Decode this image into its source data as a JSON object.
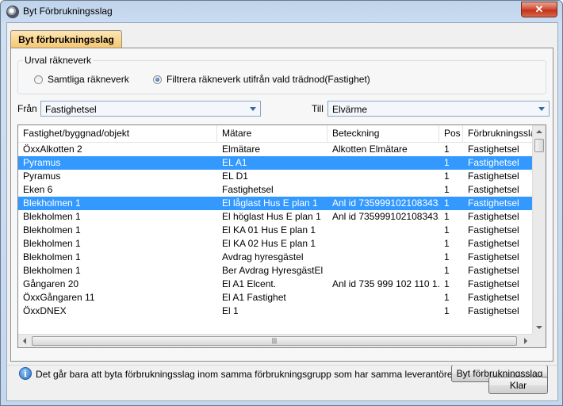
{
  "window": {
    "title": "Byt Förbrukningsslag",
    "close_label": "✕"
  },
  "tab": {
    "label": "Byt förbrukningsslag"
  },
  "urval": {
    "legend": "Urval räkneverk",
    "option_all": "Samtliga räkneverk",
    "option_filter": "Filtrera räkneverk utifrån vald trädnod(Fastighet)",
    "selected": "filter"
  },
  "from": {
    "label": "Från",
    "value": "Fastighetsel"
  },
  "to": {
    "label": "Till",
    "value": "Elvärme"
  },
  "table": {
    "columns": [
      "Fastighet/byggnad/objekt",
      "Mätare",
      "Beteckning",
      "Pos",
      "Förbrukningsslag"
    ],
    "rows": [
      {
        "c": [
          "ÖxxAlkotten 2",
          "Elmätare",
          "Alkotten Elmätare",
          "1",
          "Fastighetsel"
        ],
        "selected": false
      },
      {
        "c": [
          "Pyramus",
          "EL A1",
          "",
          "1",
          "Fastighetsel"
        ],
        "selected": true
      },
      {
        "c": [
          "Pyramus",
          "EL D1",
          "",
          "1",
          "Fastighetsel"
        ],
        "selected": false
      },
      {
        "c": [
          "Eken 6",
          "Fastighetsel",
          "",
          "1",
          "Fastighetsel"
        ],
        "selected": false
      },
      {
        "c": [
          "Blekholmen 1",
          "El låglast Hus E plan 1",
          "Anl id 735999102108343...",
          "1",
          "Fastighetsel"
        ],
        "selected": true
      },
      {
        "c": [
          "Blekholmen 1",
          "El höglast Hus E plan 1",
          "Anl id 735999102108343...",
          "1",
          "Fastighetsel"
        ],
        "selected": false
      },
      {
        "c": [
          "Blekholmen 1",
          "El KA 01 Hus E plan 1",
          "",
          "1",
          "Fastighetsel"
        ],
        "selected": false
      },
      {
        "c": [
          "Blekholmen 1",
          "El KA 02 Hus E plan 1",
          "",
          "1",
          "Fastighetsel"
        ],
        "selected": false
      },
      {
        "c": [
          "Blekholmen 1",
          "Avdrag hyresgästel",
          "",
          "1",
          "Fastighetsel"
        ],
        "selected": false
      },
      {
        "c": [
          "Blekholmen 1",
          "Ber Avdrag HyresgästEl",
          "",
          "1",
          "Fastighetsel"
        ],
        "selected": false
      },
      {
        "c": [
          "Gångaren 20",
          "El A1 Elcent.",
          "Anl id 735 999 102 110 1...",
          "1",
          "Fastighetsel"
        ],
        "selected": false
      },
      {
        "c": [
          "ÖxxGångaren 11",
          "El A1 Fastighet",
          "",
          "1",
          "Fastighetsel"
        ],
        "selected": false
      },
      {
        "c": [
          "ÖxxDNEX",
          "El 1",
          "",
          "1",
          "Fastighetsel"
        ],
        "selected": false
      }
    ]
  },
  "info": {
    "icon": "info-icon",
    "text": "Det går bara att byta förbrukningsslag inom samma förbrukningsgrupp som har samma leverantörer och tariffer"
  },
  "buttons": {
    "change": "Byt förbrukningsslag",
    "ok": "Klar"
  },
  "colors": {
    "selection": "#3399ff",
    "tab_active": "#f7c871"
  }
}
